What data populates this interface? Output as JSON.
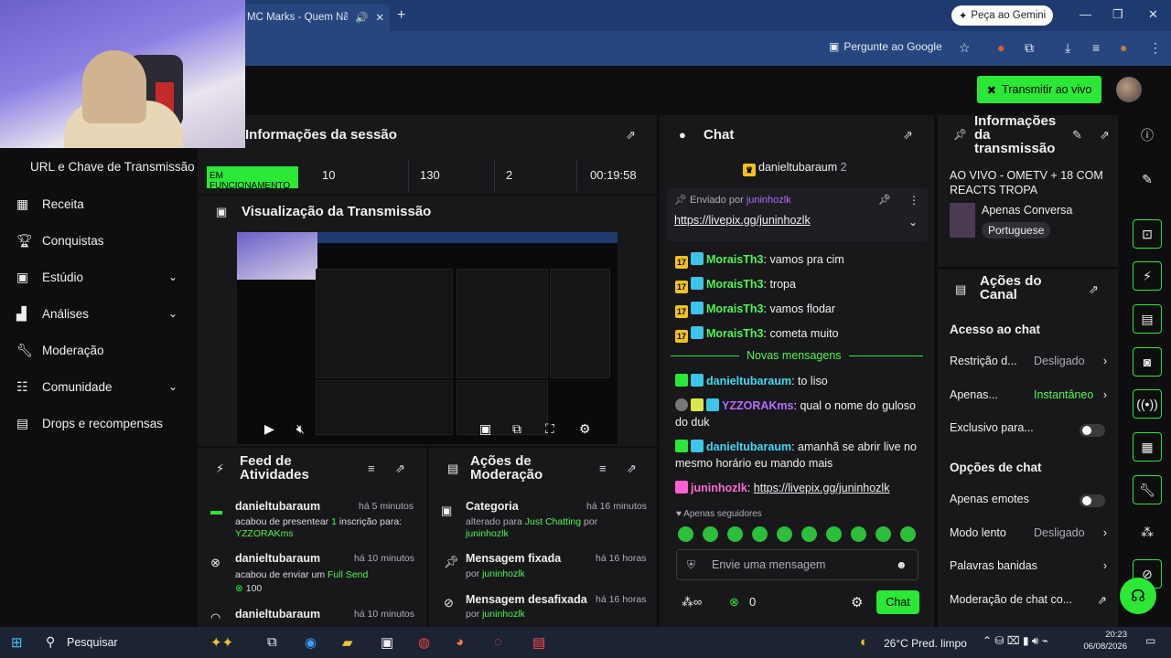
{
  "browser": {
    "tab_title": "MC Marks - Quem Não",
    "gemini_label": "Peça ao Gemini",
    "ask_google": "Pergunte ao Google"
  },
  "header": {
    "go_live": "Transmitir ao vivo"
  },
  "sidebar": {
    "url_key": "URL e Chave de Transmissão",
    "items": [
      {
        "label": "Receita"
      },
      {
        "label": "Conquistas"
      },
      {
        "label": "Estúdio"
      },
      {
        "label": "Análises"
      },
      {
        "label": "Moderação"
      },
      {
        "label": "Comunidade"
      },
      {
        "label": "Drops e recompensas"
      }
    ]
  },
  "session": {
    "title": "Informações da sessão",
    "status": "EM FUNCIONAMENTO",
    "stat1": "10",
    "stat2": "130",
    "stat3": "2",
    "uptime": "00:19:58"
  },
  "preview": {
    "title": "Visualização da Transmissão"
  },
  "activity": {
    "title": "Feed de Atividades",
    "items": [
      {
        "user": "danieltubaraum",
        "time": "há 5 minutos",
        "text_pre": "acabou de presentear ",
        "count": "1",
        "text_mid": " inscrição para:",
        "target": "YZZORAKms"
      },
      {
        "user": "danieltubaraum",
        "time": "há 10 minutos",
        "text_pre": "acabou de enviar um ",
        "highlight": "Full Send",
        "amount": "100"
      },
      {
        "user": "danieltubaraum",
        "time": "há 10 minutos"
      }
    ]
  },
  "modactions": {
    "title": "Ações de Moderação",
    "items": [
      {
        "title": "Categoria",
        "time": "há 16 minutos",
        "line_pre": "alterado para ",
        "line_hl": "Just Chatting",
        "line_post": " por",
        "by": "juninhozlk"
      },
      {
        "title": "Mensagem fixada",
        "time": "há 16 horas",
        "line_pre": "por ",
        "by": "juninhozlk"
      },
      {
        "title": "Mensagem desafixada",
        "time": "há 16 horas",
        "line_pre": "por ",
        "by": "juninhozlk"
      }
    ]
  },
  "chat": {
    "title": "Chat",
    "top_user": "danieltubaraum",
    "top_count": "2",
    "pinned_by_label": "Enviado por",
    "pinned_by": "juninhozlk",
    "pinned_link": "https://livepix.gg/juninhozlk",
    "messages": [
      {
        "user": "MoraisTh3",
        "text": "vamos pra cim"
      },
      {
        "user": "MoraisTh3",
        "text": "tropa"
      },
      {
        "user": "MoraisTh3",
        "text": "vamos flodar"
      },
      {
        "user": "MoraisTh3",
        "text": "cometa muito"
      }
    ],
    "new_messages": "Novas mensagens",
    "messages2": [
      {
        "user": "danieltubaraum",
        "text": "to liso"
      },
      {
        "user": "YZZORAKms",
        "text": "qual o nome do guloso do duk"
      },
      {
        "user": "danieltubaraum",
        "text": "amanhã se abrir live no mesmo horário eu mando mais"
      },
      {
        "user": "juninhozlk",
        "text": "https://livepix.gg/juninhozlk"
      }
    ],
    "followers_only": "Apenas seguidores",
    "input_placeholder": "Envie uma mensagem",
    "points": "0",
    "send_label": "Chat"
  },
  "stream_info": {
    "title": "Informações da transmissão",
    "stream_title": "AO VIVO - OMETV + 18 COM REACTS TROPA",
    "category": "Apenas Conversa",
    "language": "Portuguese"
  },
  "channel_actions": {
    "title": "Ações do Canal",
    "chat_access": "Acesso ao chat",
    "restriction_label": "Restrição d...",
    "restriction_value": "Desligado",
    "only_label": "Apenas...",
    "only_value": "Instantâneo",
    "exclusive_label": "Exclusivo para...",
    "chat_options": "Opções de chat",
    "emotes_only": "Apenas emotes",
    "slow_mode": "Modo lento",
    "slow_value": "Desligado",
    "banned_words": "Palavras banidas",
    "moderation": "Moderação de chat co..."
  },
  "taskbar": {
    "search": "Pesquisar",
    "weather": "26°C Pred. limpo",
    "time": "20:23",
    "date": "06/08/2026"
  },
  "colors": {
    "accent": "#2be836",
    "panel": "#18181b",
    "bg": "#0e0e10"
  }
}
